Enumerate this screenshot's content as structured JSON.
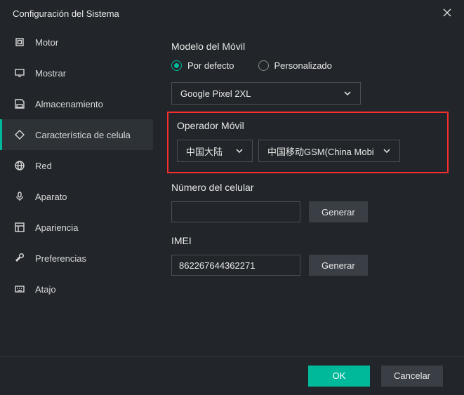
{
  "window": {
    "title": "Configuración del Sistema"
  },
  "sidebar": {
    "items": [
      {
        "label": "Motor"
      },
      {
        "label": "Mostrar"
      },
      {
        "label": "Almacenamiento"
      },
      {
        "label": "Característica de celula"
      },
      {
        "label": "Red"
      },
      {
        "label": "Aparato"
      },
      {
        "label": "Apariencia"
      },
      {
        "label": "Preferencias"
      },
      {
        "label": "Atajo"
      }
    ]
  },
  "content": {
    "model_label": "Modelo del Móvil",
    "radio_default": "Por defecto",
    "radio_custom": "Personalizado",
    "model_value": "Google Pixel 2XL",
    "operator_label": "Operador Móvil",
    "operator_region": "中国大陆",
    "operator_carrier": "中国移动GSM(China Mobi",
    "phone_label": "Número del celular",
    "phone_value": "",
    "imei_label": "IMEI",
    "imei_value": "862267644362271",
    "generate_btn": "Generar"
  },
  "footer": {
    "ok": "OK",
    "cancel": "Cancelar"
  }
}
